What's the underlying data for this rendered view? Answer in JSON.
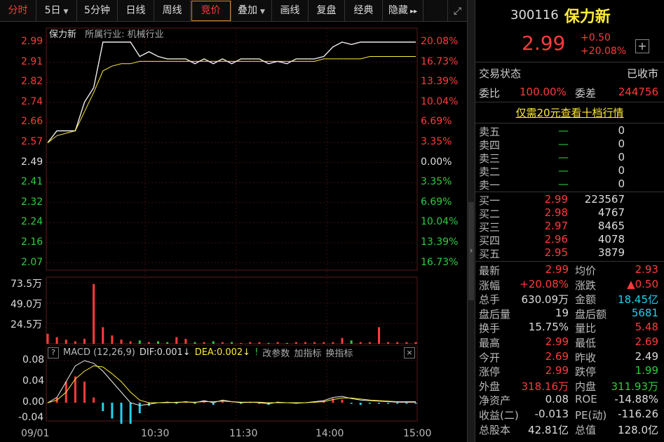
{
  "toolbar": {
    "items": [
      {
        "label": "分时",
        "state": "active"
      },
      {
        "label": "5日",
        "dropdown": true
      },
      {
        "label": "5分钟"
      },
      {
        "label": "日线"
      },
      {
        "label": "周线"
      },
      {
        "label": "竞价",
        "state": "boxed"
      },
      {
        "label": "叠加",
        "dropdown": true
      },
      {
        "label": "画线"
      },
      {
        "label": "复盘"
      },
      {
        "label": "经典"
      },
      {
        "label": "隐藏"
      }
    ],
    "more_icon": "double-chevron-right-icon",
    "expand_icon": "expand-icon"
  },
  "chart": {
    "stock_label": "保力新",
    "industry_label": "所属行业: 机械行业",
    "price_ticks": [
      "2.99",
      "2.91",
      "2.82",
      "2.74",
      "2.66",
      "2.57",
      "2.49",
      "2.41",
      "2.32",
      "2.24",
      "2.16",
      "2.07"
    ],
    "pct_ticks": [
      "20.08%",
      "16.73%",
      "13.39%",
      "10.04%",
      "6.69%",
      "3.35%",
      "0.00%",
      "3.35%",
      "6.69%",
      "10.04%",
      "13.39%",
      "16.73%"
    ],
    "volume_ticks": [
      "73.5万",
      "49.0万",
      "24.5万"
    ],
    "macd": {
      "help": "?",
      "name": "MACD (12,26,9)",
      "dif": "DIF:0.001↓",
      "dea": "DEA:0.002↓",
      "flag": "!",
      "edit": "改参数",
      "add": "加指标",
      "swap": "换指标",
      "close": "×",
      "ticks": [
        "0.08",
        "0.04",
        "0.00",
        "-0.04"
      ]
    },
    "time_ticks": [
      "09/01",
      "10:30",
      "11:30",
      "14:00",
      "15:00"
    ]
  },
  "chart_data": {
    "type": "line",
    "series": [
      {
        "values": [
          2.57,
          2.62,
          2.62,
          2.62,
          2.74,
          2.8,
          2.99,
          2.99,
          2.99,
          2.99,
          2.93,
          2.95,
          2.93,
          2.92,
          2.92,
          2.92,
          2.9,
          2.92,
          2.9,
          2.92,
          2.9,
          2.92,
          2.92,
          2.92,
          2.9,
          2.91,
          2.9,
          2.92,
          2.92,
          2.92,
          2.93,
          2.97,
          2.99,
          2.98,
          2.99,
          2.99,
          2.99,
          2.99,
          2.99,
          2.99,
          2.99
        ]
      },
      {
        "values": [
          2.57,
          2.6,
          2.61,
          2.62,
          2.7,
          2.78,
          2.87,
          2.89,
          2.9,
          2.9,
          2.91,
          2.91,
          2.91,
          2.91,
          2.91,
          2.91,
          2.91,
          2.91,
          2.91,
          2.91,
          2.91,
          2.91,
          2.91,
          2.91,
          2.91,
          2.91,
          2.91,
          2.91,
          2.91,
          2.91,
          2.92,
          2.92,
          2.92,
          2.92,
          2.92,
          2.93,
          2.93,
          2.93,
          2.93,
          2.93,
          2.93
        ]
      }
    ],
    "ylim": [
      2.07,
      2.99
    ],
    "volume": [
      12,
      8,
      5,
      3,
      6,
      72,
      20,
      10,
      5,
      3,
      4,
      2,
      3,
      2,
      8,
      6,
      2,
      2,
      3,
      2,
      2,
      1,
      2,
      2,
      1,
      2,
      1,
      2,
      2,
      2,
      2,
      2,
      7,
      4,
      2,
      2,
      20,
      2,
      2,
      2,
      2
    ],
    "macd_dif": [
      0.0,
      0.01,
      0.04,
      0.07,
      0.08,
      0.075,
      0.06,
      0.04,
      0.02,
      0.0,
      -0.005,
      -0.003,
      0.0,
      0.001,
      0.0,
      0.002,
      0.0,
      0.004,
      0.0,
      0.005,
      0.002,
      0.0,
      0.001,
      0.0,
      -0.002,
      0.001,
      0.0,
      -0.001,
      0.0,
      0.002,
      0.004,
      0.01,
      0.012,
      0.008,
      0.005,
      0.004,
      0.003,
      0.002,
      0.001,
      0.001,
      0.001
    ],
    "macd_dea": [
      0.0,
      0.005,
      0.02,
      0.045,
      0.06,
      0.07,
      0.068,
      0.055,
      0.04,
      0.02,
      0.005,
      0.0,
      0.0,
      0.0,
      0.001,
      0.001,
      0.001,
      0.002,
      0.002,
      0.003,
      0.002,
      0.001,
      0.001,
      0.001,
      0.0,
      0.0,
      0.0,
      0.0,
      0.0,
      0.001,
      0.002,
      0.006,
      0.009,
      0.009,
      0.007,
      0.005,
      0.004,
      0.003,
      0.002,
      0.002,
      0.002
    ]
  },
  "side": {
    "code": "300116",
    "name": "保力新",
    "price": "2.99",
    "change": "+0.50",
    "change_pct": "+20.08%",
    "status_label": "交易状态",
    "status_value": "已收市",
    "wb_label": "委比",
    "wb_value": "100.00%",
    "wc_label": "委差",
    "wc_value": "244756",
    "promo": "仅需20元查看十档行情",
    "asks": [
      {
        "label": "卖五",
        "price": "—",
        "vol": "0"
      },
      {
        "label": "卖四",
        "price": "—",
        "vol": "0"
      },
      {
        "label": "卖三",
        "price": "—",
        "vol": "0"
      },
      {
        "label": "卖二",
        "price": "—",
        "vol": "0"
      },
      {
        "label": "卖一",
        "price": "—",
        "vol": "0"
      }
    ],
    "bids": [
      {
        "label": "买一",
        "price": "2.99",
        "vol": "223567"
      },
      {
        "label": "买二",
        "price": "2.98",
        "vol": "4767"
      },
      {
        "label": "买三",
        "price": "2.97",
        "vol": "8465"
      },
      {
        "label": "买四",
        "price": "2.96",
        "vol": "4078"
      },
      {
        "label": "买五",
        "price": "2.95",
        "vol": "3879"
      }
    ],
    "stats": [
      {
        "l1": "最新",
        "v1": "2.99",
        "c1": "red",
        "l2": "均价",
        "v2": "2.93",
        "c2": "red"
      },
      {
        "l1": "涨幅",
        "v1": "+20.08%",
        "c1": "red",
        "l2": "涨跌",
        "v2": "▲0.50",
        "c2": "red"
      },
      {
        "l1": "总手",
        "v1": "630.09万",
        "c1": "white",
        "l2": "金额",
        "v2": "18.45亿",
        "c2": "cyan"
      },
      {
        "l1": "盘后量",
        "v1": "19",
        "c1": "white",
        "l2": "盘后额",
        "v2": "5681",
        "c2": "cyan"
      },
      {
        "l1": "换手",
        "v1": "15.75%",
        "c1": "white",
        "l2": "量比",
        "v2": "5.48",
        "c2": "red"
      },
      {
        "l1": "最高",
        "v1": "2.99",
        "c1": "red",
        "l2": "最低",
        "v2": "2.69",
        "c2": "red"
      },
      {
        "l1": "今开",
        "v1": "2.69",
        "c1": "red",
        "l2": "昨收",
        "v2": "2.49",
        "c2": "white"
      },
      {
        "l1": "涨停",
        "v1": "2.99",
        "c1": "red",
        "l2": "跌停",
        "v2": "1.99",
        "c2": "green"
      },
      {
        "l1": "外盘",
        "v1": "318.16万",
        "c1": "red",
        "l2": "内盘",
        "v2": "311.93万",
        "c2": "green"
      },
      {
        "l1": "净资产",
        "v1": "0.08",
        "c1": "white",
        "l2": "ROE",
        "v2": "-14.88%",
        "c2": "white"
      },
      {
        "l1": "收益(二)",
        "v1": "-0.013",
        "c1": "white",
        "l2": "PE(动)",
        "v2": "-116.26",
        "c2": "white"
      },
      {
        "l1": "总股本",
        "v1": "42.81亿",
        "c1": "white",
        "l2": "总值",
        "v2": "128.0亿",
        "c2": "white"
      }
    ]
  }
}
